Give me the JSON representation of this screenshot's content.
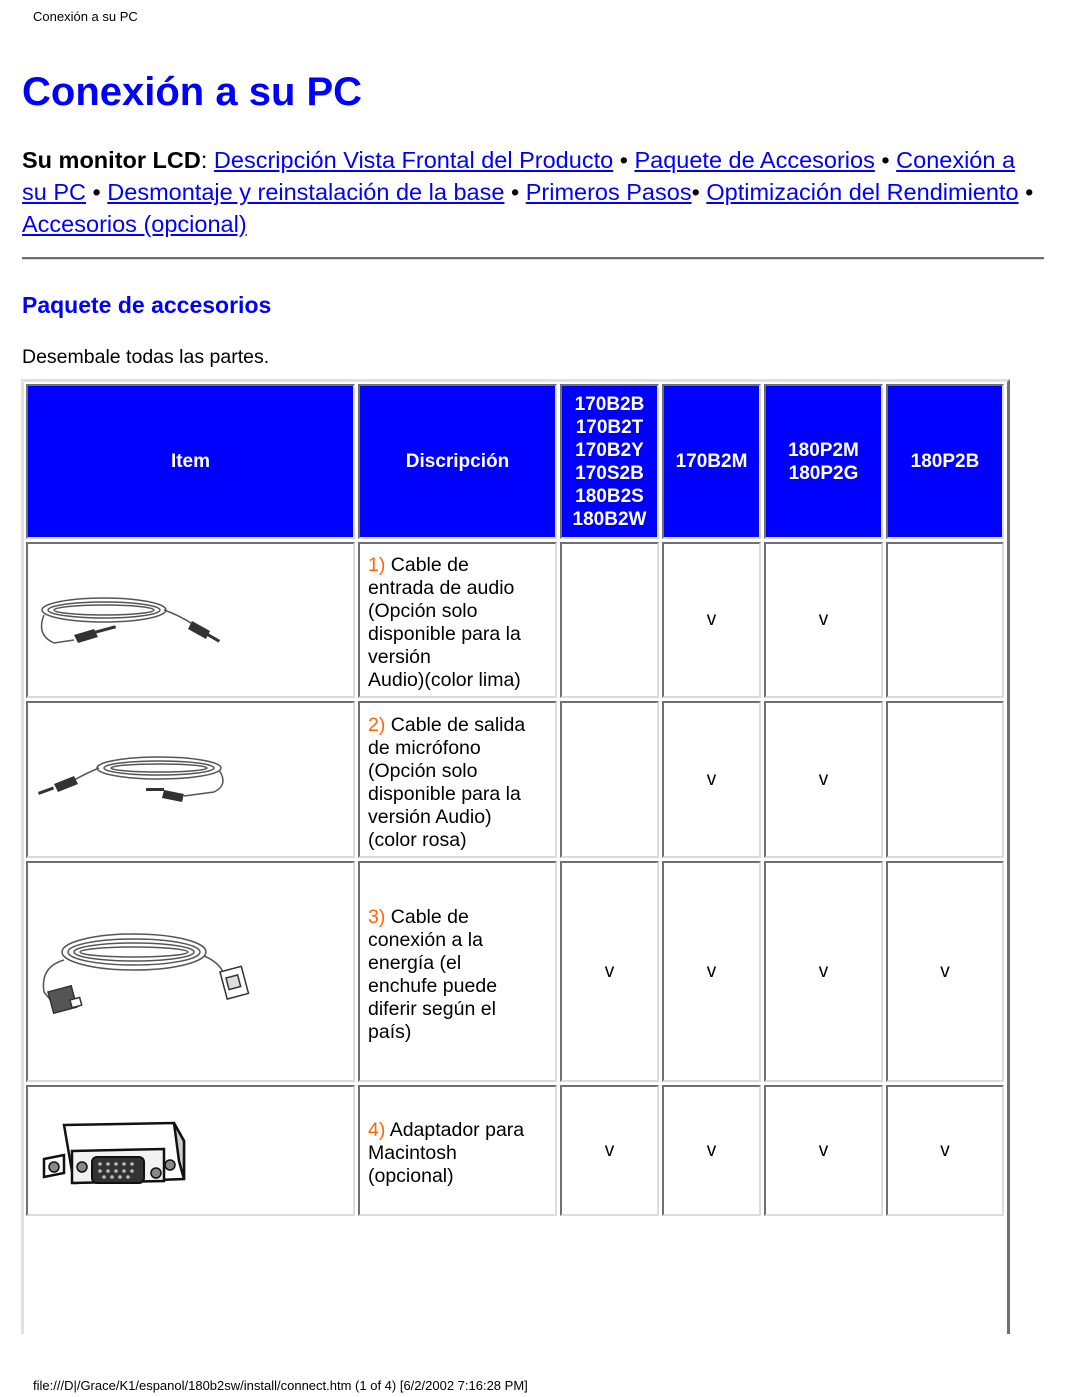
{
  "header_label": "Conexión a su PC",
  "title": "Conexión a su PC",
  "nav": {
    "prefix": "Su monitor LCD",
    "separator": "•",
    "links": [
      "Descripción Vista Frontal del Producto",
      "Paquete de Accesorios",
      "Conexión a su PC",
      "Desmontaje y reinstalación de la base",
      "Primeros Pasos",
      "Optimización del Rendimiento",
      "Accesorios (opcional)"
    ]
  },
  "section_title": "Paquete de accesorios",
  "intro": "Desembale todas las partes.",
  "table": {
    "header_bg": "#0000ff",
    "number_color": "#ff6600",
    "columns": {
      "item": "Item",
      "description": "Discripción",
      "models": [
        [
          "170B2B",
          "170B2T",
          "170B2Y",
          "170S2B",
          "180B2S",
          "180B2W"
        ],
        [
          "170B2M"
        ],
        [
          "180P2M",
          "180P2G"
        ],
        [
          "180P2B"
        ]
      ]
    },
    "rows": [
      {
        "image": "audio-in-cable-icon",
        "number": "1)",
        "lines": [
          "Cable de",
          "entrada de audio",
          "(Opción solo",
          "disponible para la",
          "versión",
          "Audio)(color lima)"
        ],
        "marks": [
          "",
          "v",
          "v",
          ""
        ]
      },
      {
        "image": "microphone-cable-icon",
        "number": "2)",
        "lines": [
          "Cable de salida",
          "de micrófono",
          "(Opción solo",
          "disponible para la",
          "versión Audio)",
          "(color rosa)"
        ],
        "marks": [
          "",
          "v",
          "v",
          ""
        ]
      },
      {
        "image": "power-cord-icon",
        "number": "3)",
        "lines": [
          "Cable de",
          "conexión a la",
          "energía (el",
          "enchufe puede",
          "diferir según el",
          "país)"
        ],
        "marks": [
          "v",
          "v",
          "v",
          "v"
        ]
      },
      {
        "image": "mac-adapter-icon",
        "number": "4)",
        "lines": [
          "Adaptador para",
          "Macintosh",
          "(opcional)"
        ],
        "marks": [
          "v",
          "v",
          "v",
          "v"
        ]
      }
    ]
  },
  "footer": "file:///D|/Grace/K1/espanol/180b2sw/install/connect.htm (1 of 4) [6/2/2002 7:16:28 PM]"
}
